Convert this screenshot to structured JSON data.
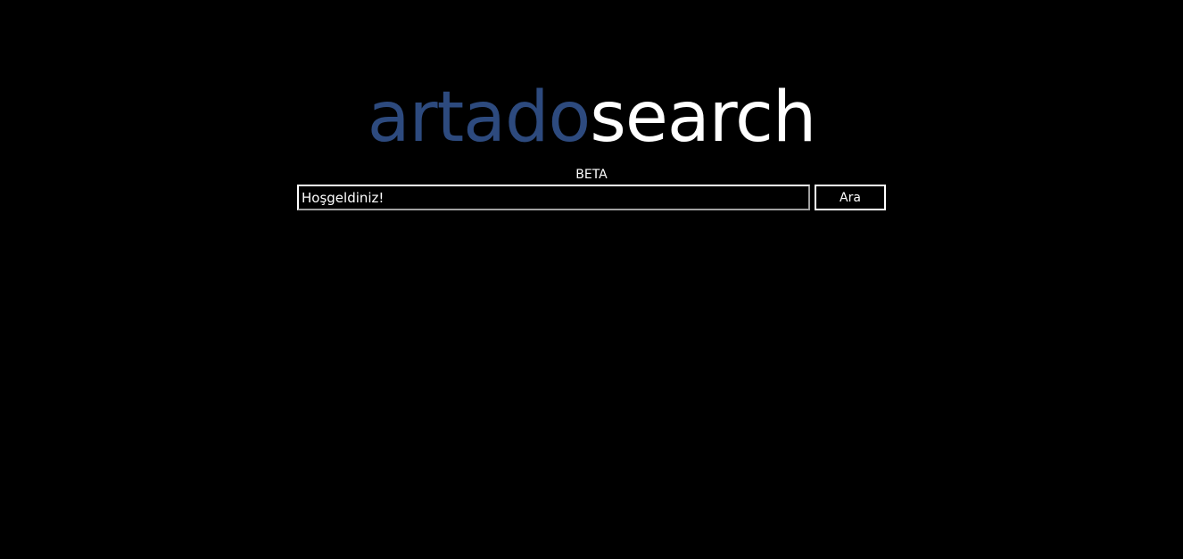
{
  "logo": {
    "part_a": "artado",
    "part_b": "search",
    "part_a_color": "#2d4a7e",
    "part_b_color": "#ffffff"
  },
  "badge": {
    "label": "BETA"
  },
  "search": {
    "value": "Hoşgeldiniz!",
    "button_label": "Ara"
  },
  "colors": {
    "background": "#000000",
    "text": "#ffffff"
  }
}
